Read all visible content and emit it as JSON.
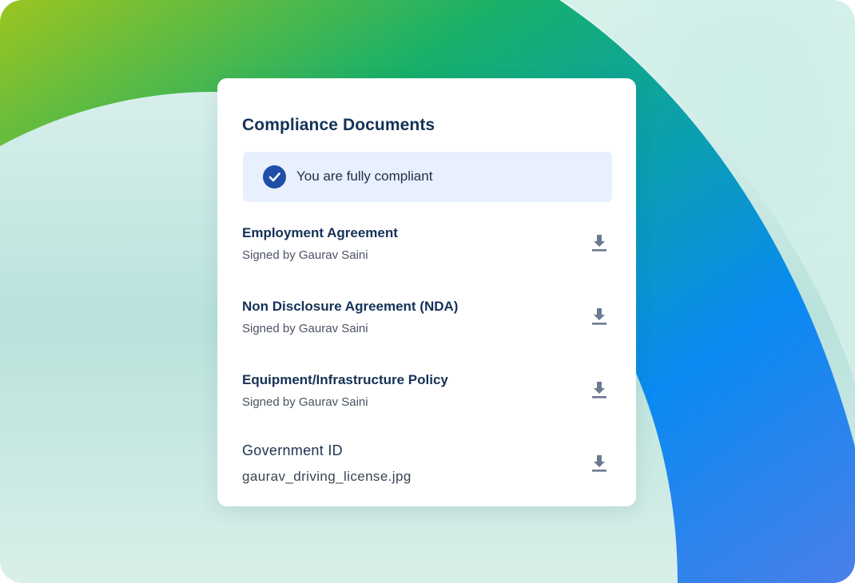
{
  "card": {
    "title": "Compliance Documents"
  },
  "status": {
    "text": "You are fully compliant",
    "icon": "check-circle-icon",
    "color": "#1d4fa8"
  },
  "documents": [
    {
      "title": "Employment Agreement",
      "subtitle": "Signed by Gaurav Saini",
      "action_icon": "download-icon"
    },
    {
      "title": "Non Disclosure Agreement (NDA)",
      "subtitle": "Signed by Gaurav Saini",
      "action_icon": "download-icon"
    },
    {
      "title": "Equipment/Infrastructure Policy",
      "subtitle": "Signed by Gaurav Saini",
      "action_icon": "download-icon"
    },
    {
      "title": "Government ID",
      "subtitle": "gaurav_driving_license.jpg",
      "action_icon": "download-icon"
    }
  ],
  "colors": {
    "title": "#143257",
    "banner_bg": "#e8efff",
    "icon": "#6b7a90"
  }
}
